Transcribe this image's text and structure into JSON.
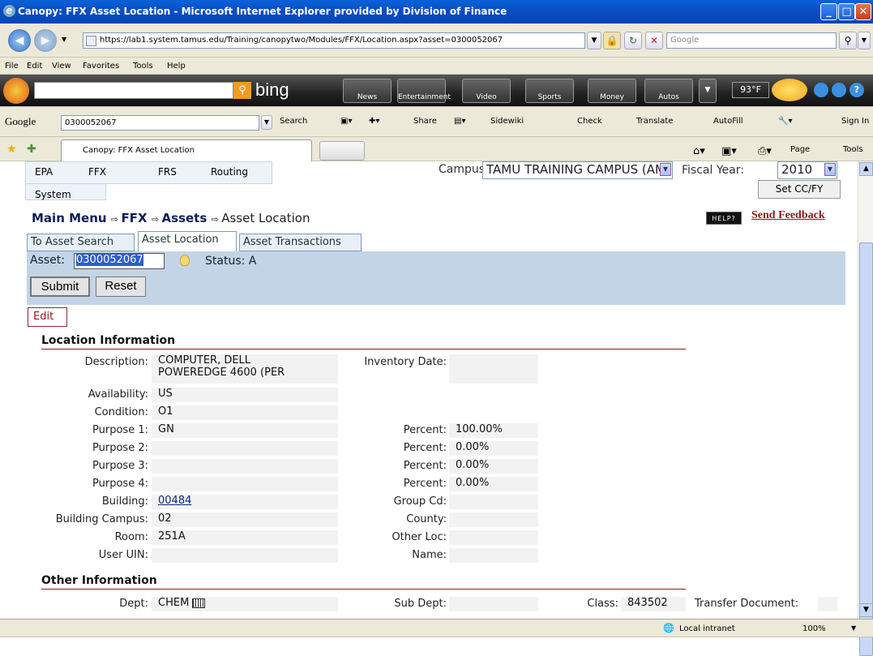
{
  "window": {
    "title": "Canopy: FFX Asset Location - Microsoft Internet Explorer provided by Division of Finance"
  },
  "address": {
    "url": "https://lab1.system.tamus.edu/Training/canopytwo/Modules/FFX/Location.aspx?asset=0300052067",
    "search_placeholder": "Google"
  },
  "menu": [
    "File",
    "Edit",
    "View",
    "Favorites",
    "Tools",
    "Help"
  ],
  "bing": {
    "logo": "bing",
    "tabs": [
      "News",
      "Entertainment",
      "Video",
      "Sports",
      "Money",
      "Autos"
    ],
    "temp": "93°F"
  },
  "google": {
    "logo": "Google",
    "query": "0300052067",
    "search": "Search",
    "share": "Share",
    "sidewiki": "Sidewiki",
    "check": "Check",
    "translate": "Translate",
    "autofill": "AutoFill",
    "signin": "Sign In"
  },
  "tabs": {
    "active": "Canopy: FFX Asset Location",
    "page": "Page",
    "tools": "Tools"
  },
  "status": {
    "zone": "Local intranet",
    "zoom": "100%"
  },
  "app": {
    "modules": [
      "EPA",
      "FFX",
      "FRS",
      "Routing",
      "System"
    ],
    "campus_label": "Campus:",
    "campus_value": "TAMU TRAINING CAMPUS (AM)",
    "fy_label": "Fiscal Year:",
    "fy_value": "2010",
    "set_cc": "Set CC/FY",
    "breadcrumb": {
      "main": "Main Menu",
      "ffx": "FFX",
      "assets": "Assets",
      "current": "Asset Location"
    },
    "help": "HELP?",
    "feedback": "Send Feedback",
    "page_tabs": [
      "To Asset Search",
      "Asset Location",
      "Asset Transactions"
    ],
    "asset_label": "Asset:",
    "asset_value": "0300052067",
    "status_text": "Status: A",
    "submit": "Submit",
    "reset": "Reset",
    "edit": "Edit",
    "location_title": "Location Information",
    "fields": {
      "description_label": "Description:",
      "description_1": "COMPUTER, DELL",
      "description_2": "POWEREDGE 4600 (PER",
      "inventory_label": "Inventory Date:",
      "inventory_value": "",
      "availability_label": "Availability:",
      "availability_value": "US",
      "condition_label": "Condition:",
      "condition_value": "O1",
      "purpose1_label": "Purpose 1:",
      "purpose1_value": "GN",
      "purpose2_label": "Purpose 2:",
      "purpose2_value": "",
      "purpose3_label": "Purpose 3:",
      "purpose3_value": "",
      "purpose4_label": "Purpose 4:",
      "purpose4_value": "",
      "percent_label": "Percent:",
      "percent1": "100.00%",
      "percent2": "0.00%",
      "percent3": "0.00%",
      "percent4": "0.00%",
      "building_label": "Building:",
      "building_value": "00484",
      "groupcd_label": "Group Cd:",
      "groupcd_value": "",
      "bcampus_label": "Building Campus:",
      "bcampus_value": "02",
      "county_label": "County:",
      "county_value": "",
      "room_label": "Room:",
      "room_value": "251A",
      "otherloc_label": "Other Loc:",
      "otherloc_value": "",
      "useruin_label": "User UIN:",
      "useruin_value": "",
      "name_label": "Name:",
      "name_value": ""
    },
    "other_title": "Other Information",
    "other": {
      "dept_label": "Dept:",
      "dept_value": "CHEM",
      "subdept_label": "Sub Dept:",
      "class_label": "Class:",
      "class_value": "843502",
      "transfer_label": "Transfer Document:"
    }
  }
}
